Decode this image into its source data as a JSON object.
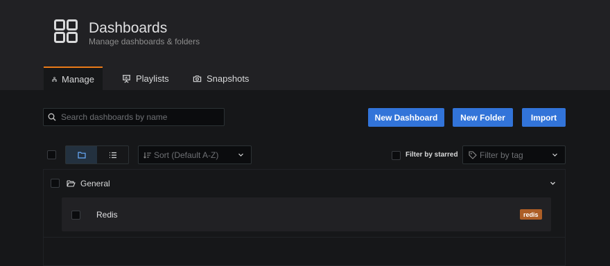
{
  "header": {
    "title": "Dashboards",
    "subtitle": "Manage dashboards & folders",
    "icon": "dashboards-grid-icon"
  },
  "tabs": [
    {
      "label": "Manage",
      "icon": "sitemap-icon",
      "active": true
    },
    {
      "label": "Playlists",
      "icon": "presentation-icon",
      "active": false
    },
    {
      "label": "Snapshots",
      "icon": "camera-icon",
      "active": false
    }
  ],
  "actions": {
    "search_placeholder": "Search dashboards by name",
    "new_dashboard": "New Dashboard",
    "new_folder": "New Folder",
    "import": "Import"
  },
  "filters": {
    "sort_label": "Sort (Default A-Z)",
    "starred_label": "Filter by starred",
    "tag_placeholder": "Filter by tag"
  },
  "folder": {
    "name": "General",
    "expanded": true,
    "dashboards": [
      {
        "title": "Redis",
        "tags": [
          "redis"
        ]
      }
    ]
  },
  "colors": {
    "accent": "#eb7b18",
    "primary_button": "#3274d9",
    "tag_redis": "#ad5e26",
    "background": "#161719",
    "panel": "#212124"
  }
}
